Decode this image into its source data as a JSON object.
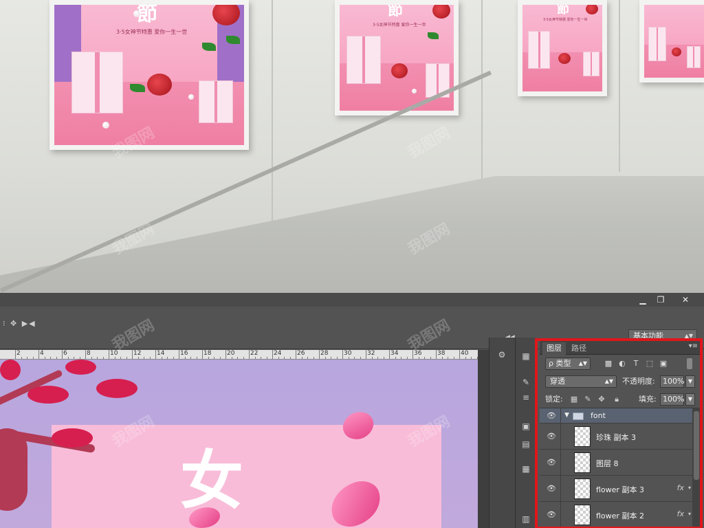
{
  "mockup": {
    "posters": [
      {
        "sub": "3·5女神节特惠 爱你一生一世"
      },
      {
        "sub": "3·5女神节特惠 爱你一生一世"
      },
      {
        "sub": "3·5女神节特惠 爱你一生一世"
      },
      {
        "sub": ""
      }
    ]
  },
  "photoshop": {
    "window_controls": {
      "minimize": "▁",
      "restore": "❐",
      "close": "✕"
    },
    "workspace": {
      "label": "基本功能",
      "arrow": "▲▼"
    },
    "ruler_numbers": [
      "2",
      "4",
      "6",
      "8",
      "10",
      "12",
      "14",
      "16",
      "18",
      "20",
      "22",
      "24",
      "26",
      "28",
      "30",
      "32",
      "34",
      "36",
      "38",
      "40"
    ],
    "canvas": {
      "big_character": "女"
    },
    "layers_panel": {
      "tabs": [
        {
          "label": "图层",
          "active": true
        },
        {
          "label": "路径",
          "active": false
        }
      ],
      "filter": {
        "label": "ρ 类型"
      },
      "blend_mode": "穿透",
      "opacity_label": "不透明度:",
      "opacity_value": "100%",
      "lock_label": "锁定:",
      "fill_label": "填充:",
      "fill_value": "100%",
      "layers": [
        {
          "name": "font",
          "type": "group",
          "fx": false
        },
        {
          "name": "珍珠 副本 3",
          "type": "layer",
          "fx": false
        },
        {
          "name": "图层 8",
          "type": "layer",
          "fx": false
        },
        {
          "name": "flower 副本 3",
          "type": "layer",
          "fx": true
        },
        {
          "name": "flower 副本 2",
          "type": "layer",
          "fx": true
        }
      ]
    },
    "highlight_color": "#e0161b"
  },
  "watermark_text": "我图网",
  "icons": {
    "eye": "eye-icon",
    "folder": "folder-icon",
    "fx": "fx-icon",
    "lock": "lock-icon"
  }
}
